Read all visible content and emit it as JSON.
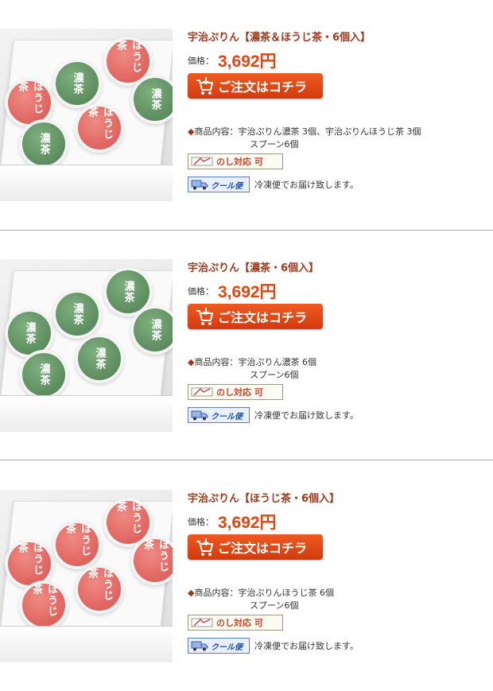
{
  "items": [
    {
      "title": "宇治ぷりん【濃茶＆ほうじ茶・6個入】",
      "price_label": "価格：",
      "price": "3,692円",
      "order_button": "ご注文はコチラ",
      "contents_bullet": "◆",
      "contents_line1": "商品内容：宇治ぷりん濃茶 3個、宇治ぷりんほうじ茶 3個",
      "contents_line2": "スプーン6個",
      "noshi_label": "のし対応 可",
      "cool_label": "クール便",
      "cool_text": "冷凍便でお届け致します。",
      "jars": [
        {
          "kind": "red",
          "label": "ほうじ茶"
        },
        {
          "kind": "green",
          "label": "濃茶"
        },
        {
          "kind": "red",
          "label": "ほうじ茶"
        },
        {
          "kind": "red",
          "label": "ほうじ茶"
        },
        {
          "kind": "green",
          "label": "濃茶"
        },
        {
          "kind": "green",
          "label": "濃茶"
        }
      ]
    },
    {
      "title": "宇治ぷりん【濃茶・6個入】",
      "price_label": "価格：",
      "price": "3,692円",
      "order_button": "ご注文はコチラ",
      "contents_bullet": "◆",
      "contents_line1": "商品内容：宇治ぷりん濃茶 6個",
      "contents_line2": "スプーン6個",
      "noshi_label": "のし対応 可",
      "cool_label": "クール便",
      "cool_text": "冷凍便でお届け致します。",
      "jars": [
        {
          "kind": "green",
          "label": "濃茶"
        },
        {
          "kind": "green",
          "label": "濃茶"
        },
        {
          "kind": "green",
          "label": "濃茶"
        },
        {
          "kind": "green",
          "label": "濃茶"
        },
        {
          "kind": "green",
          "label": "濃茶"
        },
        {
          "kind": "green",
          "label": "濃茶"
        }
      ]
    },
    {
      "title": "宇治ぷりん【ほうじ茶・6個入】",
      "price_label": "価格：",
      "price": "3,692円",
      "order_button": "ご注文はコチラ",
      "contents_bullet": "◆",
      "contents_line1": "商品内容：宇治ぷりんほうじ茶 6個",
      "contents_line2": "スプーン6個",
      "noshi_label": "のし対応 可",
      "cool_label": "クール便",
      "cool_text": "冷凍便でお届け致します。",
      "jars": [
        {
          "kind": "red",
          "label": "ほうじ茶"
        },
        {
          "kind": "red",
          "label": "ほうじ茶"
        },
        {
          "kind": "red",
          "label": "ほうじ茶"
        },
        {
          "kind": "red",
          "label": "ほうじ茶"
        },
        {
          "kind": "red",
          "label": "ほうじ茶"
        },
        {
          "kind": "red",
          "label": "ほうじ茶"
        }
      ]
    }
  ]
}
